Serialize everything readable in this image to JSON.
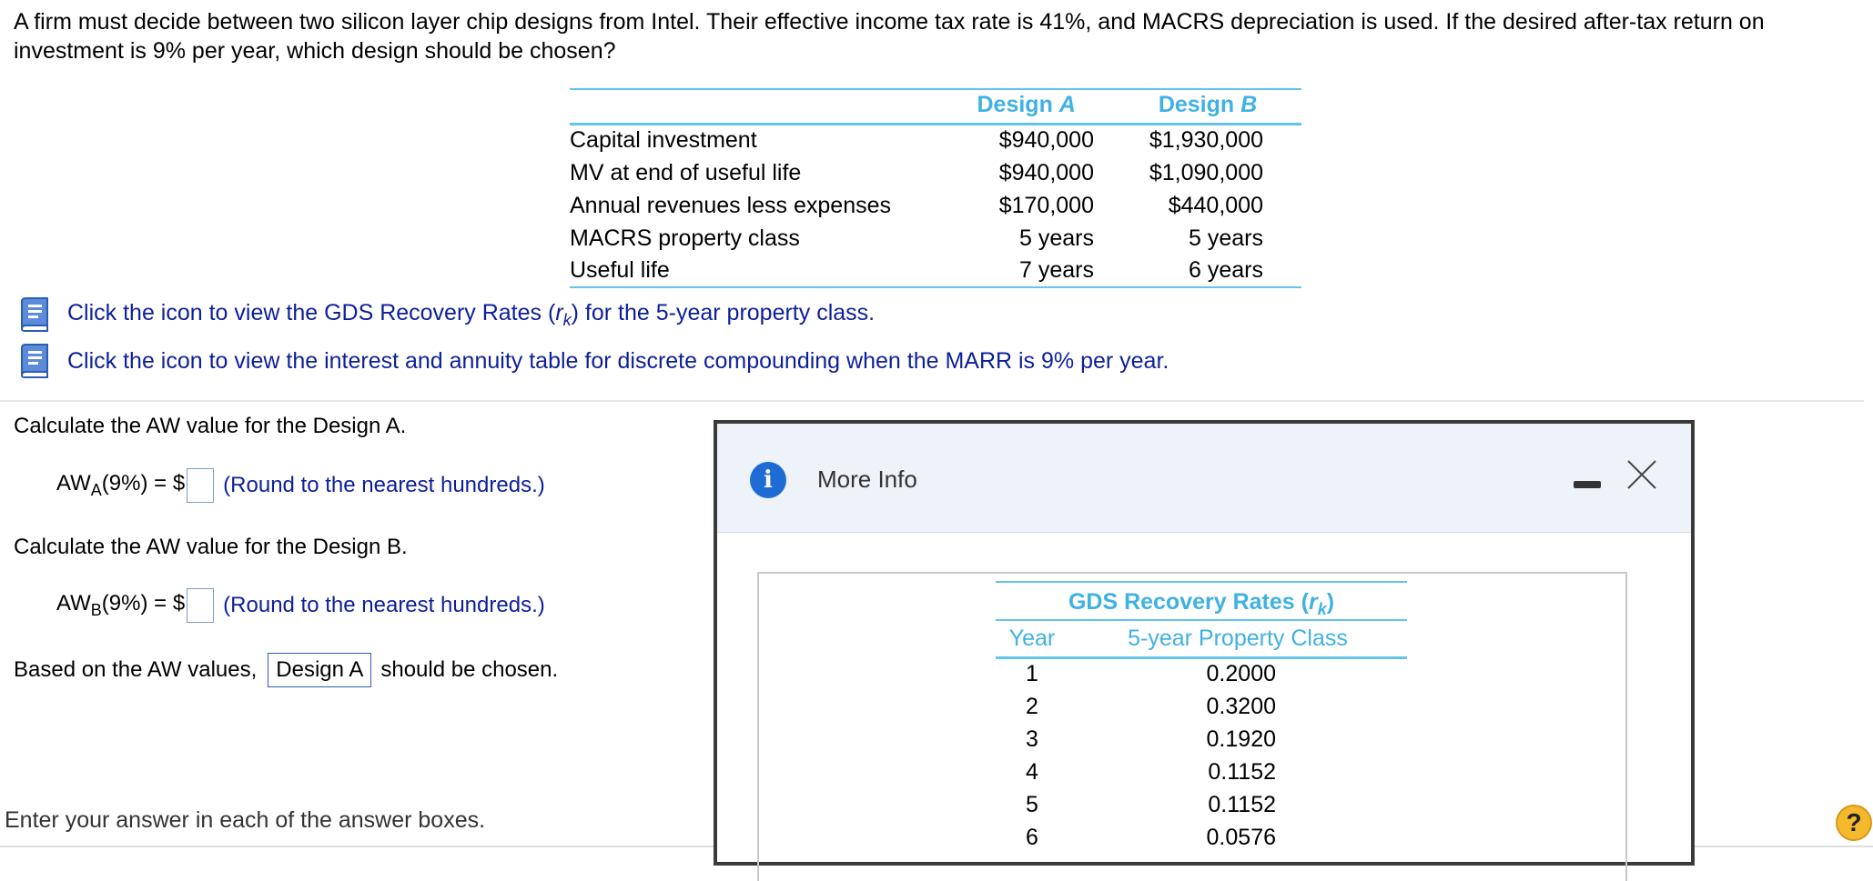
{
  "problem": {
    "text": "A firm must decide between two silicon layer chip designs from Intel. Their effective income tax rate is 41%, and MACRS depreciation is used. If the desired after-tax return on investment is 9% per year, which design should be chosen?"
  },
  "table": {
    "headers": {
      "label": "",
      "a_prefix": "Design ",
      "a_suffix": "A",
      "b_prefix": "Design ",
      "b_suffix": "B"
    },
    "rows": [
      {
        "label": "Capital investment",
        "a": "$940,000",
        "b": "$1,930,000"
      },
      {
        "label": "MV at end of useful life",
        "a": "$940,000",
        "b": "$1,090,000"
      },
      {
        "label": "Annual revenues less expenses",
        "a": "$170,000",
        "b": "$440,000"
      },
      {
        "label": "MACRS property class",
        "a": "5 years",
        "b": "5 years"
      },
      {
        "label": "Useful life",
        "a": "7 years",
        "b": "6 years"
      }
    ]
  },
  "links": {
    "gds": {
      "before": "Click the icon to view the GDS Recovery Rates (",
      "symbol": "r",
      "sub": "k",
      "after": ") for the 5-year property class."
    },
    "interest": {
      "text": "Click the icon to view the interest and annuity table for discrete compounding when the MARR is 9% per year."
    }
  },
  "questions": {
    "q1": "Calculate the AW value for the Design A.",
    "aw_a": {
      "prefix": "AW",
      "sub": "A",
      "suffix": "(9%) = $",
      "hint": "(Round to the nearest hundreds.)"
    },
    "q2": "Calculate the AW value for the Design B.",
    "aw_b": {
      "prefix": "AW",
      "sub": "B",
      "suffix": "(9%) = $",
      "hint": "(Round to the nearest hundreds.)"
    },
    "choice": {
      "before": "Based on the AW values,",
      "selected": "Design A",
      "after": "should be chosen."
    }
  },
  "footer": {
    "text": "Enter your answer in each of the answer boxes."
  },
  "help": {
    "label": "?"
  },
  "modal": {
    "title": "More Info",
    "gds_table": {
      "caption_prefix": "GDS Recovery Rates (",
      "caption_symbol": "r",
      "caption_sub": "k",
      "caption_suffix": ")",
      "col_year": "Year",
      "col_rate": "5-year Property Class",
      "rows": [
        {
          "year": "1",
          "rate": "0.2000"
        },
        {
          "year": "2",
          "rate": "0.3200"
        },
        {
          "year": "3",
          "rate": "0.1920"
        },
        {
          "year": "4",
          "rate": "0.1152"
        },
        {
          "year": "5",
          "rate": "0.1152"
        },
        {
          "year": "6",
          "rate": "0.0576"
        }
      ]
    }
  },
  "colors": {
    "accent_blue": "#3fb1e3",
    "link_blue": "#0d1f9a",
    "help_yellow": "#f5b92e"
  }
}
